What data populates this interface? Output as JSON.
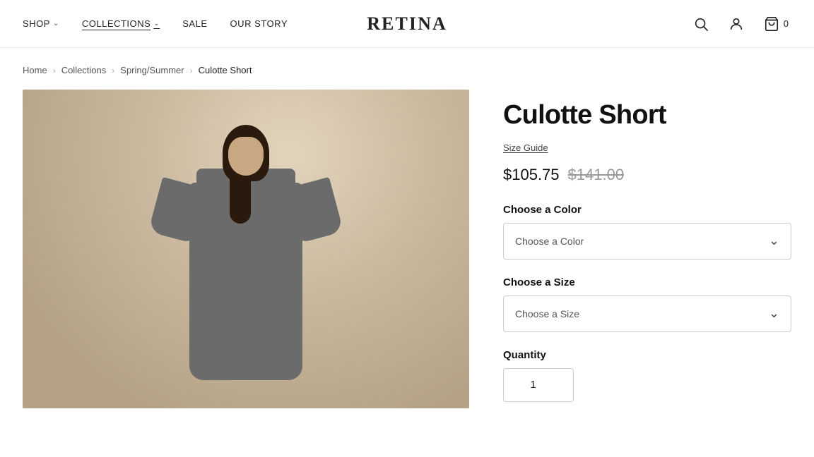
{
  "header": {
    "logo": "RETINA",
    "nav": [
      {
        "id": "shop",
        "label": "SHOP",
        "hasDropdown": true
      },
      {
        "id": "collections",
        "label": "COLLECTIONS",
        "hasDropdown": true,
        "active": true
      },
      {
        "id": "sale",
        "label": "SALE",
        "hasDropdown": false
      },
      {
        "id": "our-story",
        "label": "OUR STORY",
        "hasDropdown": false
      }
    ],
    "cart_count": "0"
  },
  "breadcrumb": {
    "items": [
      {
        "label": "Home",
        "link": true
      },
      {
        "label": "Collections",
        "link": true
      },
      {
        "label": "Spring/Summer",
        "link": true
      },
      {
        "label": "Culotte Short",
        "link": false
      }
    ]
  },
  "product": {
    "title": "Culotte Short",
    "size_guide_label": "Size Guide",
    "price_current": "$105.75",
    "price_original": "$141.00",
    "choose_color_label": "Choose a Color",
    "color_placeholder": "Choose a Color",
    "choose_size_label": "Choose a Size",
    "size_placeholder": "Choose a Size",
    "quantity_label": "Quantity",
    "quantity_value": ""
  }
}
